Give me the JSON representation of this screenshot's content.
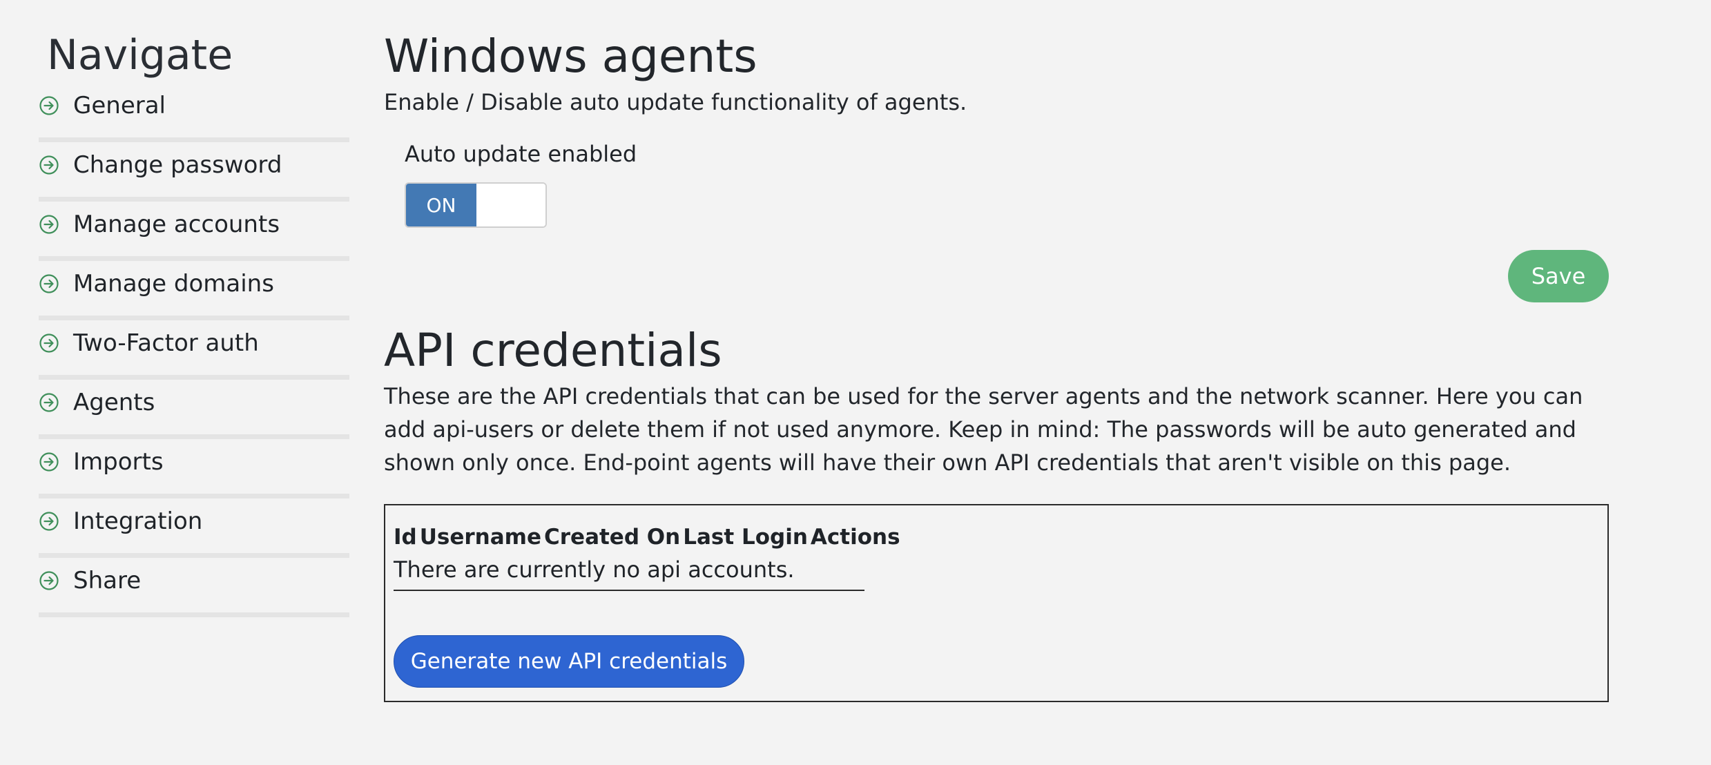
{
  "sidebar": {
    "title": "Navigate",
    "items": [
      {
        "label": "General",
        "icon": "arrow-circle-right-icon"
      },
      {
        "label": "Change password",
        "icon": "arrow-circle-right-icon"
      },
      {
        "label": "Manage accounts",
        "icon": "arrow-circle-right-icon"
      },
      {
        "label": "Manage domains",
        "icon": "arrow-circle-right-icon"
      },
      {
        "label": "Two-Factor auth",
        "icon": "arrow-circle-right-icon"
      },
      {
        "label": "Agents",
        "icon": "arrow-circle-right-icon"
      },
      {
        "label": "Imports",
        "icon": "arrow-circle-right-icon"
      },
      {
        "label": "Integration",
        "icon": "arrow-circle-right-icon"
      },
      {
        "label": "Share",
        "icon": "arrow-circle-right-icon"
      }
    ],
    "icon_color": "#3f8f5a"
  },
  "windows_agents": {
    "title": "Windows agents",
    "description": "Enable / Disable auto update functionality of agents.",
    "toggle_label": "Auto update enabled",
    "toggle_state": "ON",
    "save_label": "Save"
  },
  "api_credentials": {
    "title": "API credentials",
    "description": "These are the API credentials that can be used for the server agents and the network scanner. Here you can add api-users or delete them if not used anymore. Keep in mind: The passwords will be auto generated and shown only once. End-point agents will have their own API credentials that aren't visible on this page.",
    "columns": [
      "Id",
      "Username",
      "Created On",
      "Last Login",
      "Actions"
    ],
    "empty_message": "There are currently no api accounts.",
    "generate_label": "Generate new API credentials"
  },
  "colors": {
    "background": "#f3f3f3",
    "toggle_on": "#4379b4",
    "save_button": "#5fb67c",
    "generate_button": "#2e65d2"
  }
}
